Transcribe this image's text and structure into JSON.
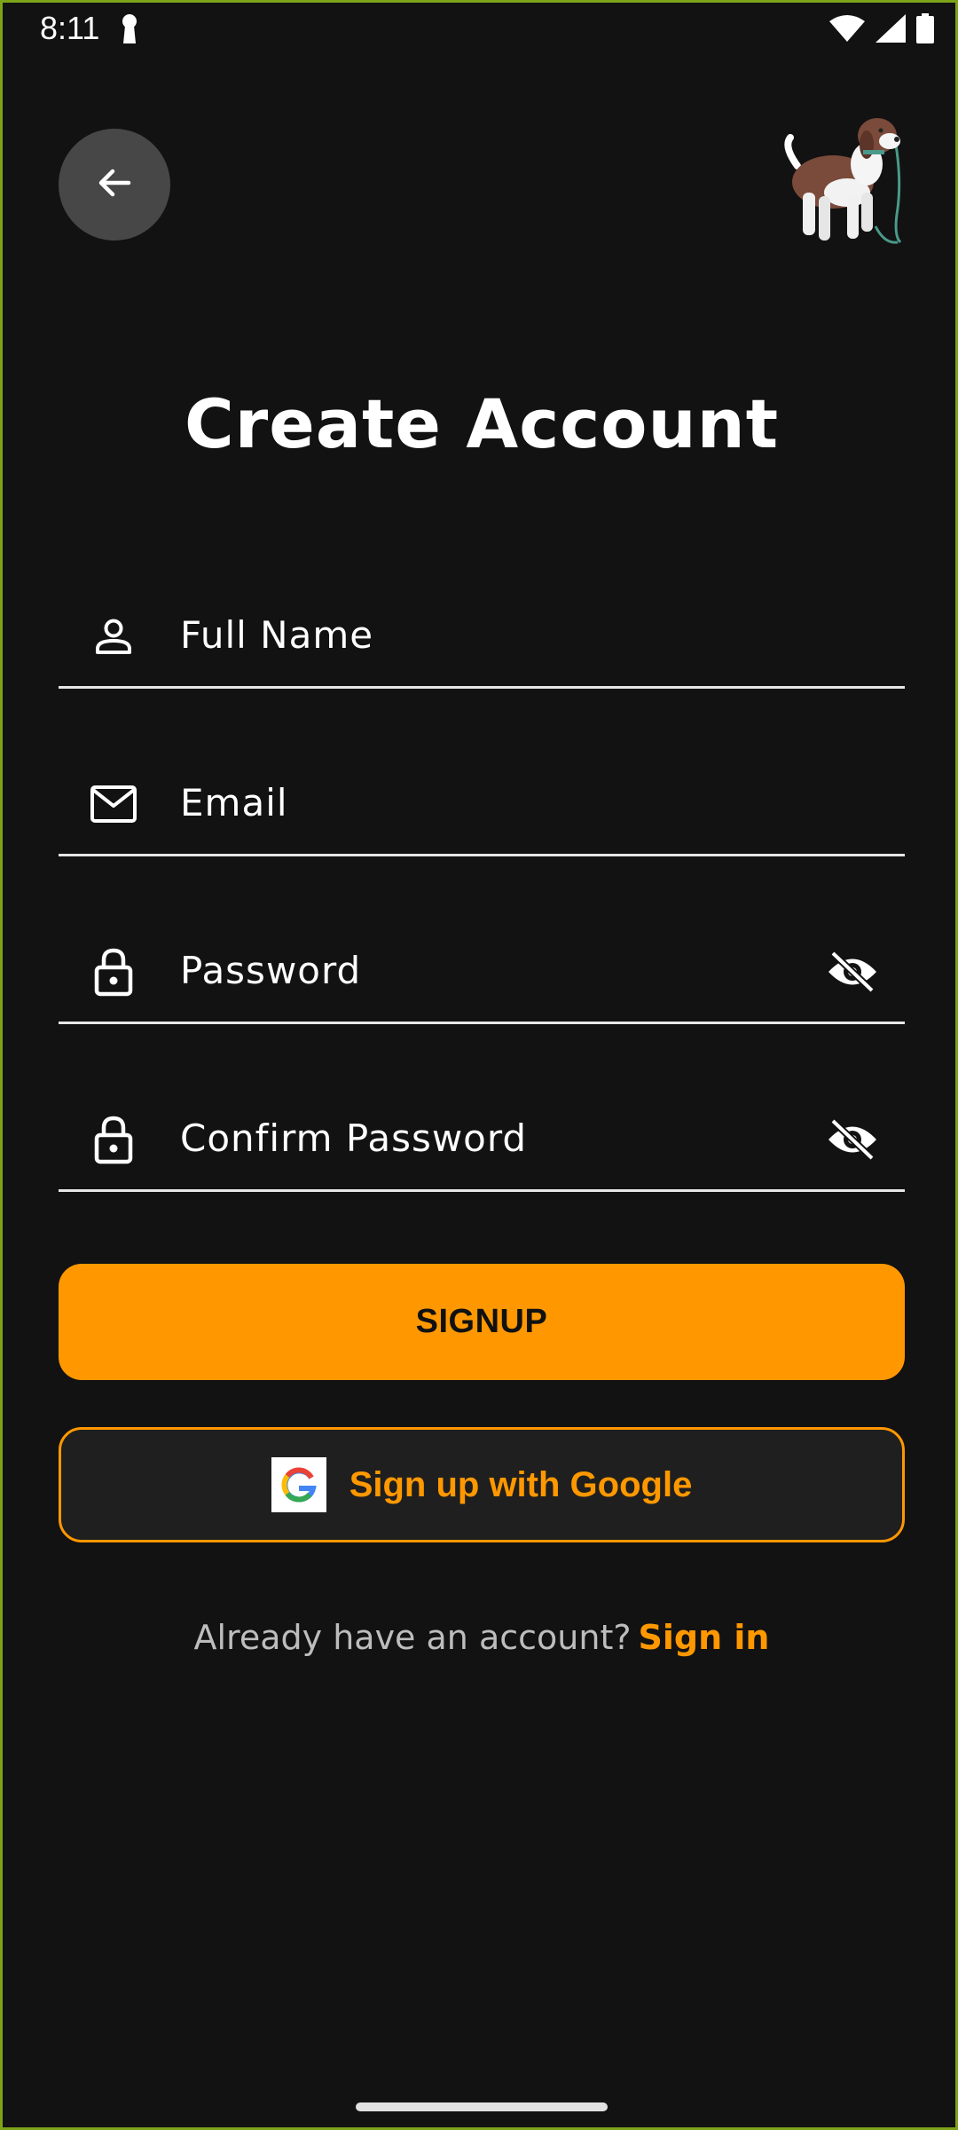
{
  "status_bar": {
    "time": "8:11",
    "icons": [
      "key-icon",
      "wifi-icon",
      "signal-icon",
      "battery-icon"
    ]
  },
  "header": {
    "back_icon": "arrow-left-icon",
    "illustration": "dog-illustration"
  },
  "title": "Create Account",
  "form": {
    "full_name": {
      "placeholder": "Full Name",
      "icon": "person-icon"
    },
    "email": {
      "placeholder": "Email",
      "icon": "mail-icon"
    },
    "password": {
      "placeholder": "Password",
      "icon": "lock-icon",
      "toggle_icon": "eye-off-icon"
    },
    "confirm_password": {
      "placeholder": "Confirm Password",
      "icon": "lock-icon",
      "toggle_icon": "eye-off-icon"
    }
  },
  "buttons": {
    "signup": "SIGNUP",
    "google": "Sign up with Google"
  },
  "footer": {
    "prompt": "Already have an account?",
    "link": "Sign in"
  },
  "colors": {
    "background": "#121212",
    "accent": "#ff9800",
    "field_underline": "#e6e6e6",
    "back_button": "#474747",
    "google_button_bg": "#1f1f1f"
  }
}
